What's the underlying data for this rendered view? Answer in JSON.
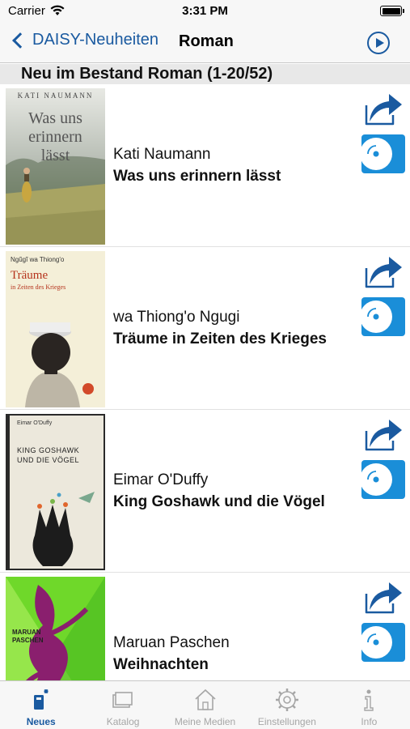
{
  "status_bar": {
    "carrier": "Carrier",
    "time": "3:31 PM"
  },
  "nav": {
    "back_label": "DAISY-Neuheiten",
    "title": "Roman",
    "play_icon": "play-circle-icon"
  },
  "section": {
    "header": "Neu im Bestand Roman (1-20/52)"
  },
  "books": [
    {
      "author": "Kati Naumann",
      "title": "Was uns erinnern lässt",
      "cover": {
        "small_text": "KATI NAUMANN",
        "line1": "Was uns",
        "line2": "erinnern",
        "line3": "lässt"
      }
    },
    {
      "author": "wa Thiong'o Ngugi",
      "title": "Träume in Zeiten des Krieges",
      "cover": {
        "small_text": "Ngũgĩ wa Thiong'o",
        "line1": "Träume",
        "line2": "in Zeiten des Krieges"
      }
    },
    {
      "author": "Eimar O'Duffy",
      "title": "King Goshawk und die Vögel",
      "cover": {
        "small_text": "Eimar O'Duffy",
        "line1": "KING GOSHAWK",
        "line2": "UND DIE VÖGEL"
      }
    },
    {
      "author": "Maruan Paschen",
      "title": "Weihnachten",
      "cover": {
        "small_text": "MARUAN",
        "line1": "PASCHEN"
      }
    }
  ],
  "tabs": [
    {
      "label": "Neues",
      "icon": "new-items-icon",
      "active": true
    },
    {
      "label": "Katalog",
      "icon": "catalog-icon",
      "active": false
    },
    {
      "label": "Meine Medien",
      "icon": "home-icon",
      "active": false
    },
    {
      "label": "Einstellungen",
      "icon": "gear-icon",
      "active": false
    },
    {
      "label": "Info",
      "icon": "info-icon",
      "active": false
    }
  ],
  "colors": {
    "accent": "#1a5aa0",
    "disc_button": "#1a8ed8",
    "section_bg": "#e8e8e8",
    "inactive_tab": "#a6a6a6"
  }
}
